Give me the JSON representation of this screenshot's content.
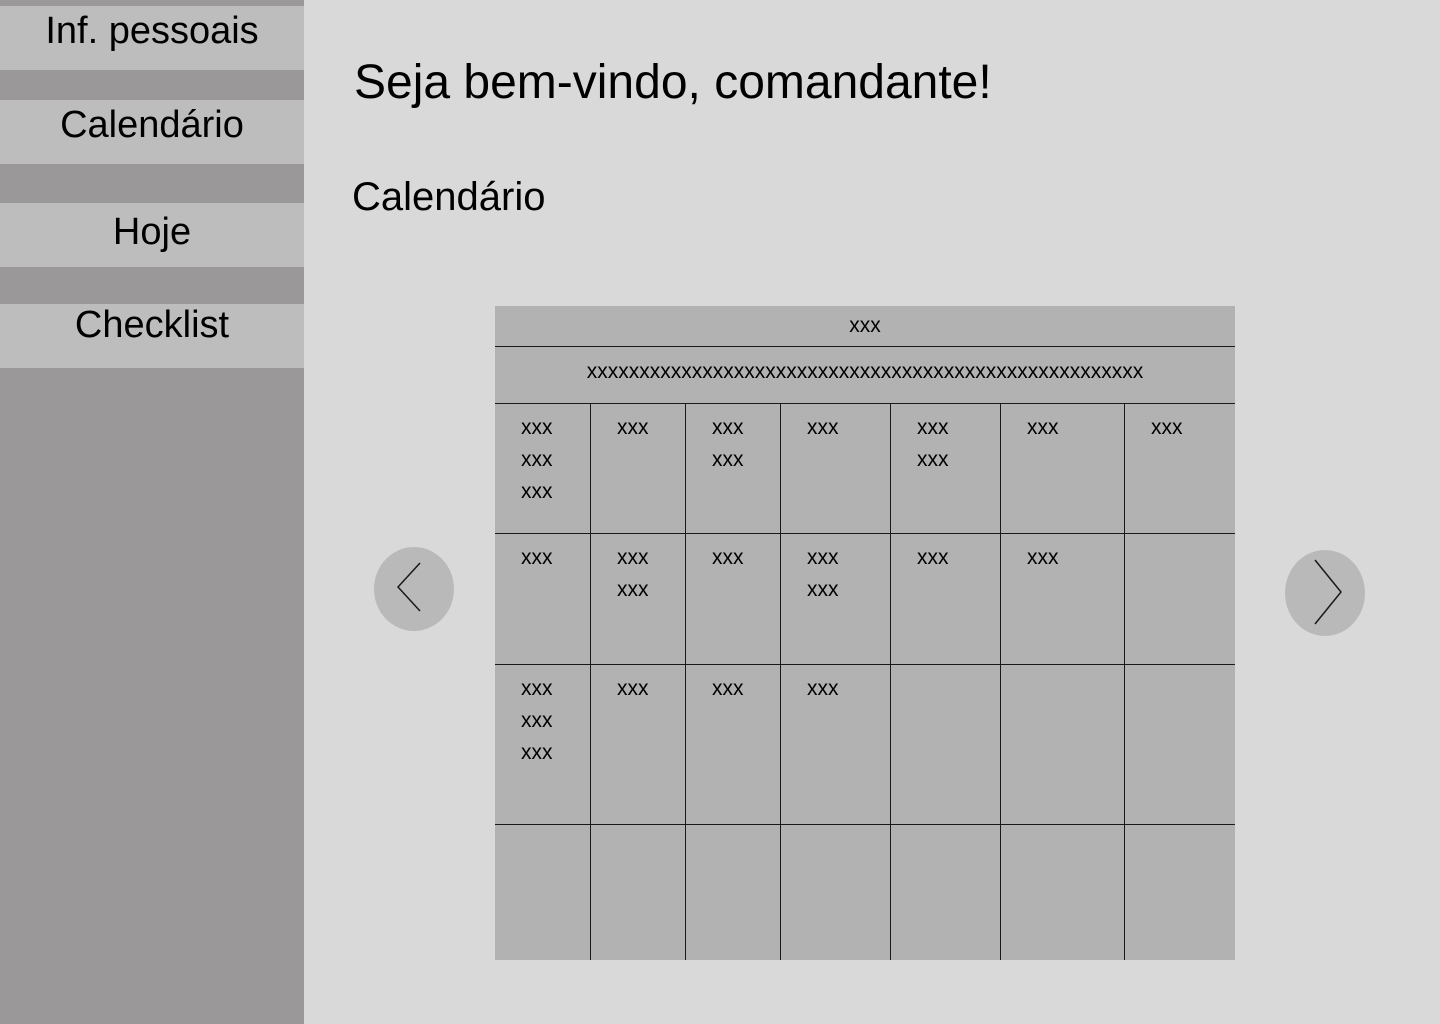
{
  "sidebar": {
    "items": [
      {
        "label": "Inf. pessoais"
      },
      {
        "label": "Calendário"
      },
      {
        "label": "Hoje"
      },
      {
        "label": "Checklist"
      }
    ]
  },
  "main": {
    "title": "Seja bem-vindo, comandante!",
    "section_title": "Calendário"
  },
  "calendar": {
    "month_label": "xxx",
    "weekdays_label": "xxxxxxxxxxxxxxxxxxxxxxxxxxxxxxxxxxxxxxxxxxxxxxxxxxxxx",
    "weeks": [
      [
        [
          "xxx",
          "xxx",
          "xxx"
        ],
        [
          "xxx"
        ],
        [
          "xxx",
          "xxx"
        ],
        [
          "xxx"
        ],
        [
          "xxx",
          "xxx"
        ],
        [
          "xxx"
        ],
        [
          "xxx"
        ]
      ],
      [
        [
          "xxx"
        ],
        [
          "xxx",
          "xxx"
        ],
        [
          "xxx"
        ],
        [
          "xxx",
          "xxx"
        ],
        [
          "xxx"
        ],
        [
          "xxx"
        ],
        []
      ],
      [
        [
          "xxx",
          "xxx",
          "xxx"
        ],
        [
          "xxx"
        ],
        [
          "xxx"
        ],
        [
          "xxx"
        ],
        [],
        [],
        []
      ],
      [
        [],
        [],
        [],
        [],
        [],
        [],
        []
      ]
    ]
  },
  "nav": {
    "prev_icon": "chevron-left-icon",
    "next_icon": "chevron-right-icon"
  }
}
